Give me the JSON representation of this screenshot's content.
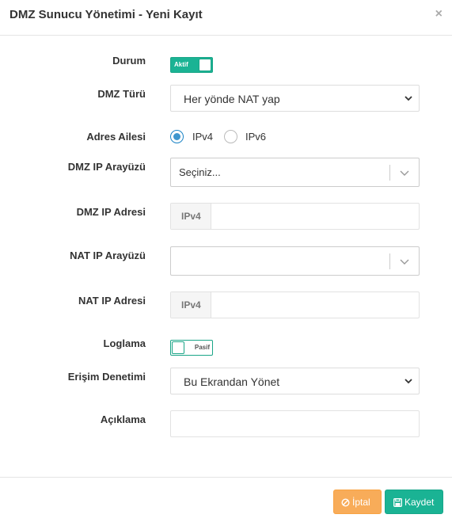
{
  "modal": {
    "title": "DMZ Sunucu Yönetimi - Yeni Kayıt",
    "close_symbol": "×"
  },
  "form": {
    "durum": {
      "label": "Durum",
      "toggle_text": "Aktif",
      "state": "on"
    },
    "dmz_turu": {
      "label": "DMZ Türü",
      "value": "Her yönde NAT yap"
    },
    "adres_ailesi": {
      "label": "Adres Ailesi",
      "options": [
        "IPv4",
        "IPv6"
      ],
      "selected": "IPv4"
    },
    "dmz_ip_arayuzu": {
      "label": "DMZ IP Arayüzü",
      "value": "Seçiniz..."
    },
    "dmz_ip_adresi": {
      "label": "DMZ IP Adresi",
      "addon": "IPv4",
      "value": ""
    },
    "nat_ip_arayuzu": {
      "label": "NAT IP Arayüzü",
      "value": ""
    },
    "nat_ip_adresi": {
      "label": "NAT IP Adresi",
      "addon": "IPv4",
      "value": ""
    },
    "loglama": {
      "label": "Loglama",
      "toggle_text": "Pasif",
      "state": "off"
    },
    "erisim_denetimi": {
      "label": "Erişim Denetimi",
      "value": "Bu Ekrandan Yönet"
    },
    "aciklama": {
      "label": "Açıklama",
      "value": ""
    }
  },
  "footer": {
    "cancel_label": "İptal",
    "save_label": "Kaydet"
  },
  "colors": {
    "toggle_green": "#1ab394",
    "cancel_orange": "#f8ac59",
    "save_green": "#1ab394",
    "radio_blue": "#1c84c6"
  },
  "icons": {
    "cancel": "ban-icon",
    "save": "floppy-disk-icon",
    "close": "close-icon",
    "dropdown": "chevron-down-icon"
  }
}
